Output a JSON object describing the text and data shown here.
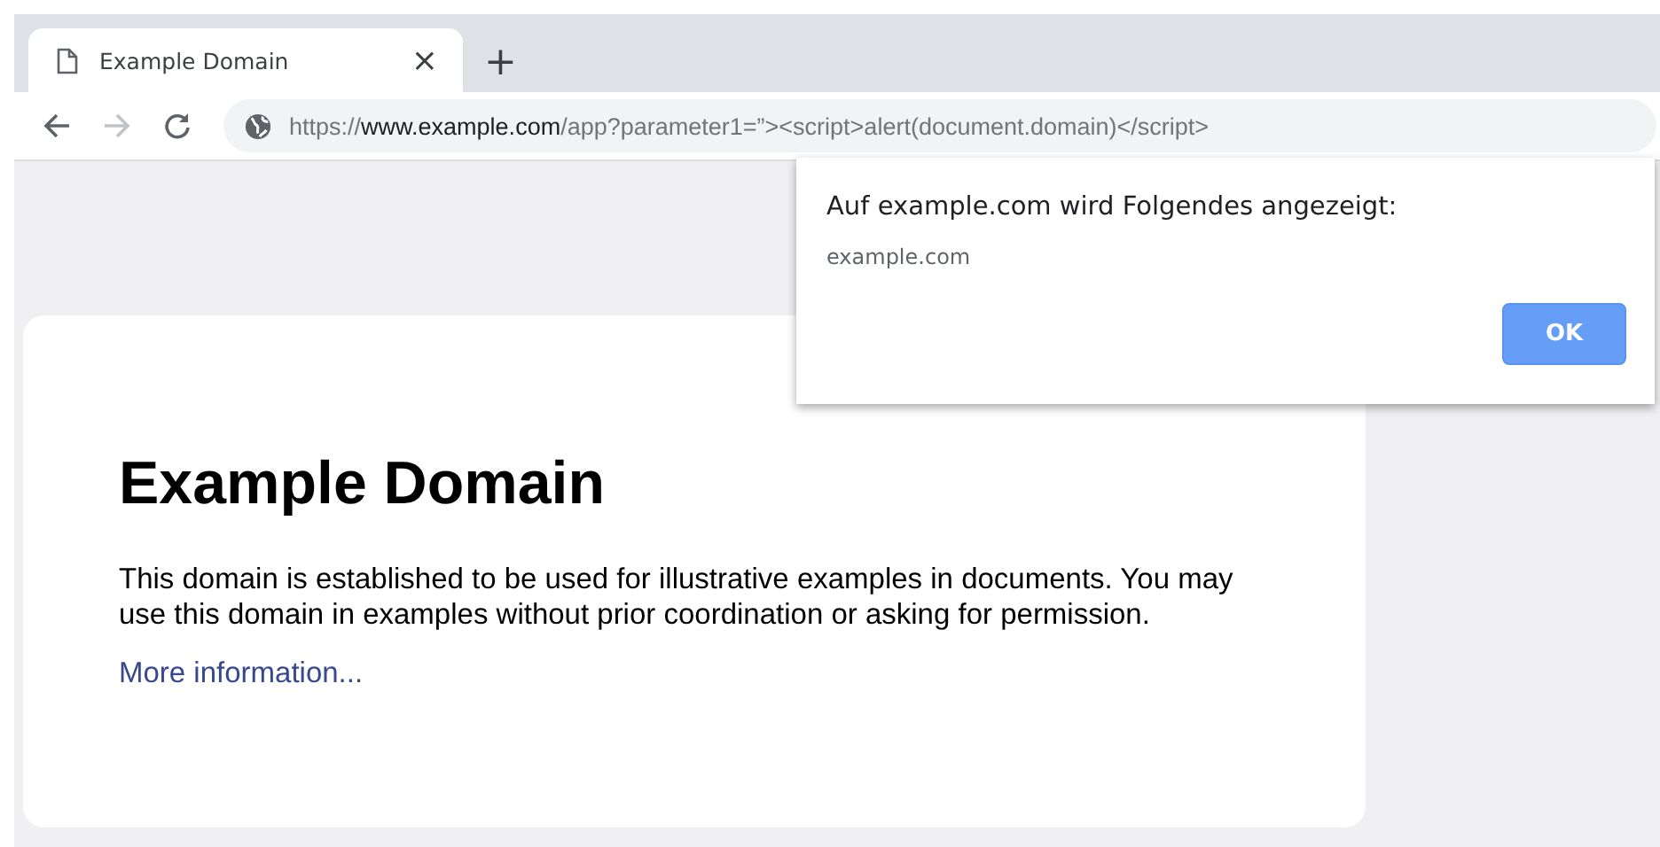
{
  "tabs": [
    {
      "title": "Example Domain",
      "selected": true
    }
  ],
  "new_tab": "+",
  "close_tab": "×",
  "address_bar": {
    "scheme": "https://",
    "host": "www.example.com",
    "path": "/app?parameter1=”><script>alert(document.domain)</script>"
  },
  "page": {
    "heading": "Example Domain",
    "paragraph": "This domain is established to be used for illustrative examples in documents. You may use this domain in examples without prior coordination or asking for permission.",
    "link": "More information..."
  },
  "dialog": {
    "title": "Auf example.com wird Folgendes angezeigt:",
    "message": "example.com",
    "button": "OK"
  }
}
